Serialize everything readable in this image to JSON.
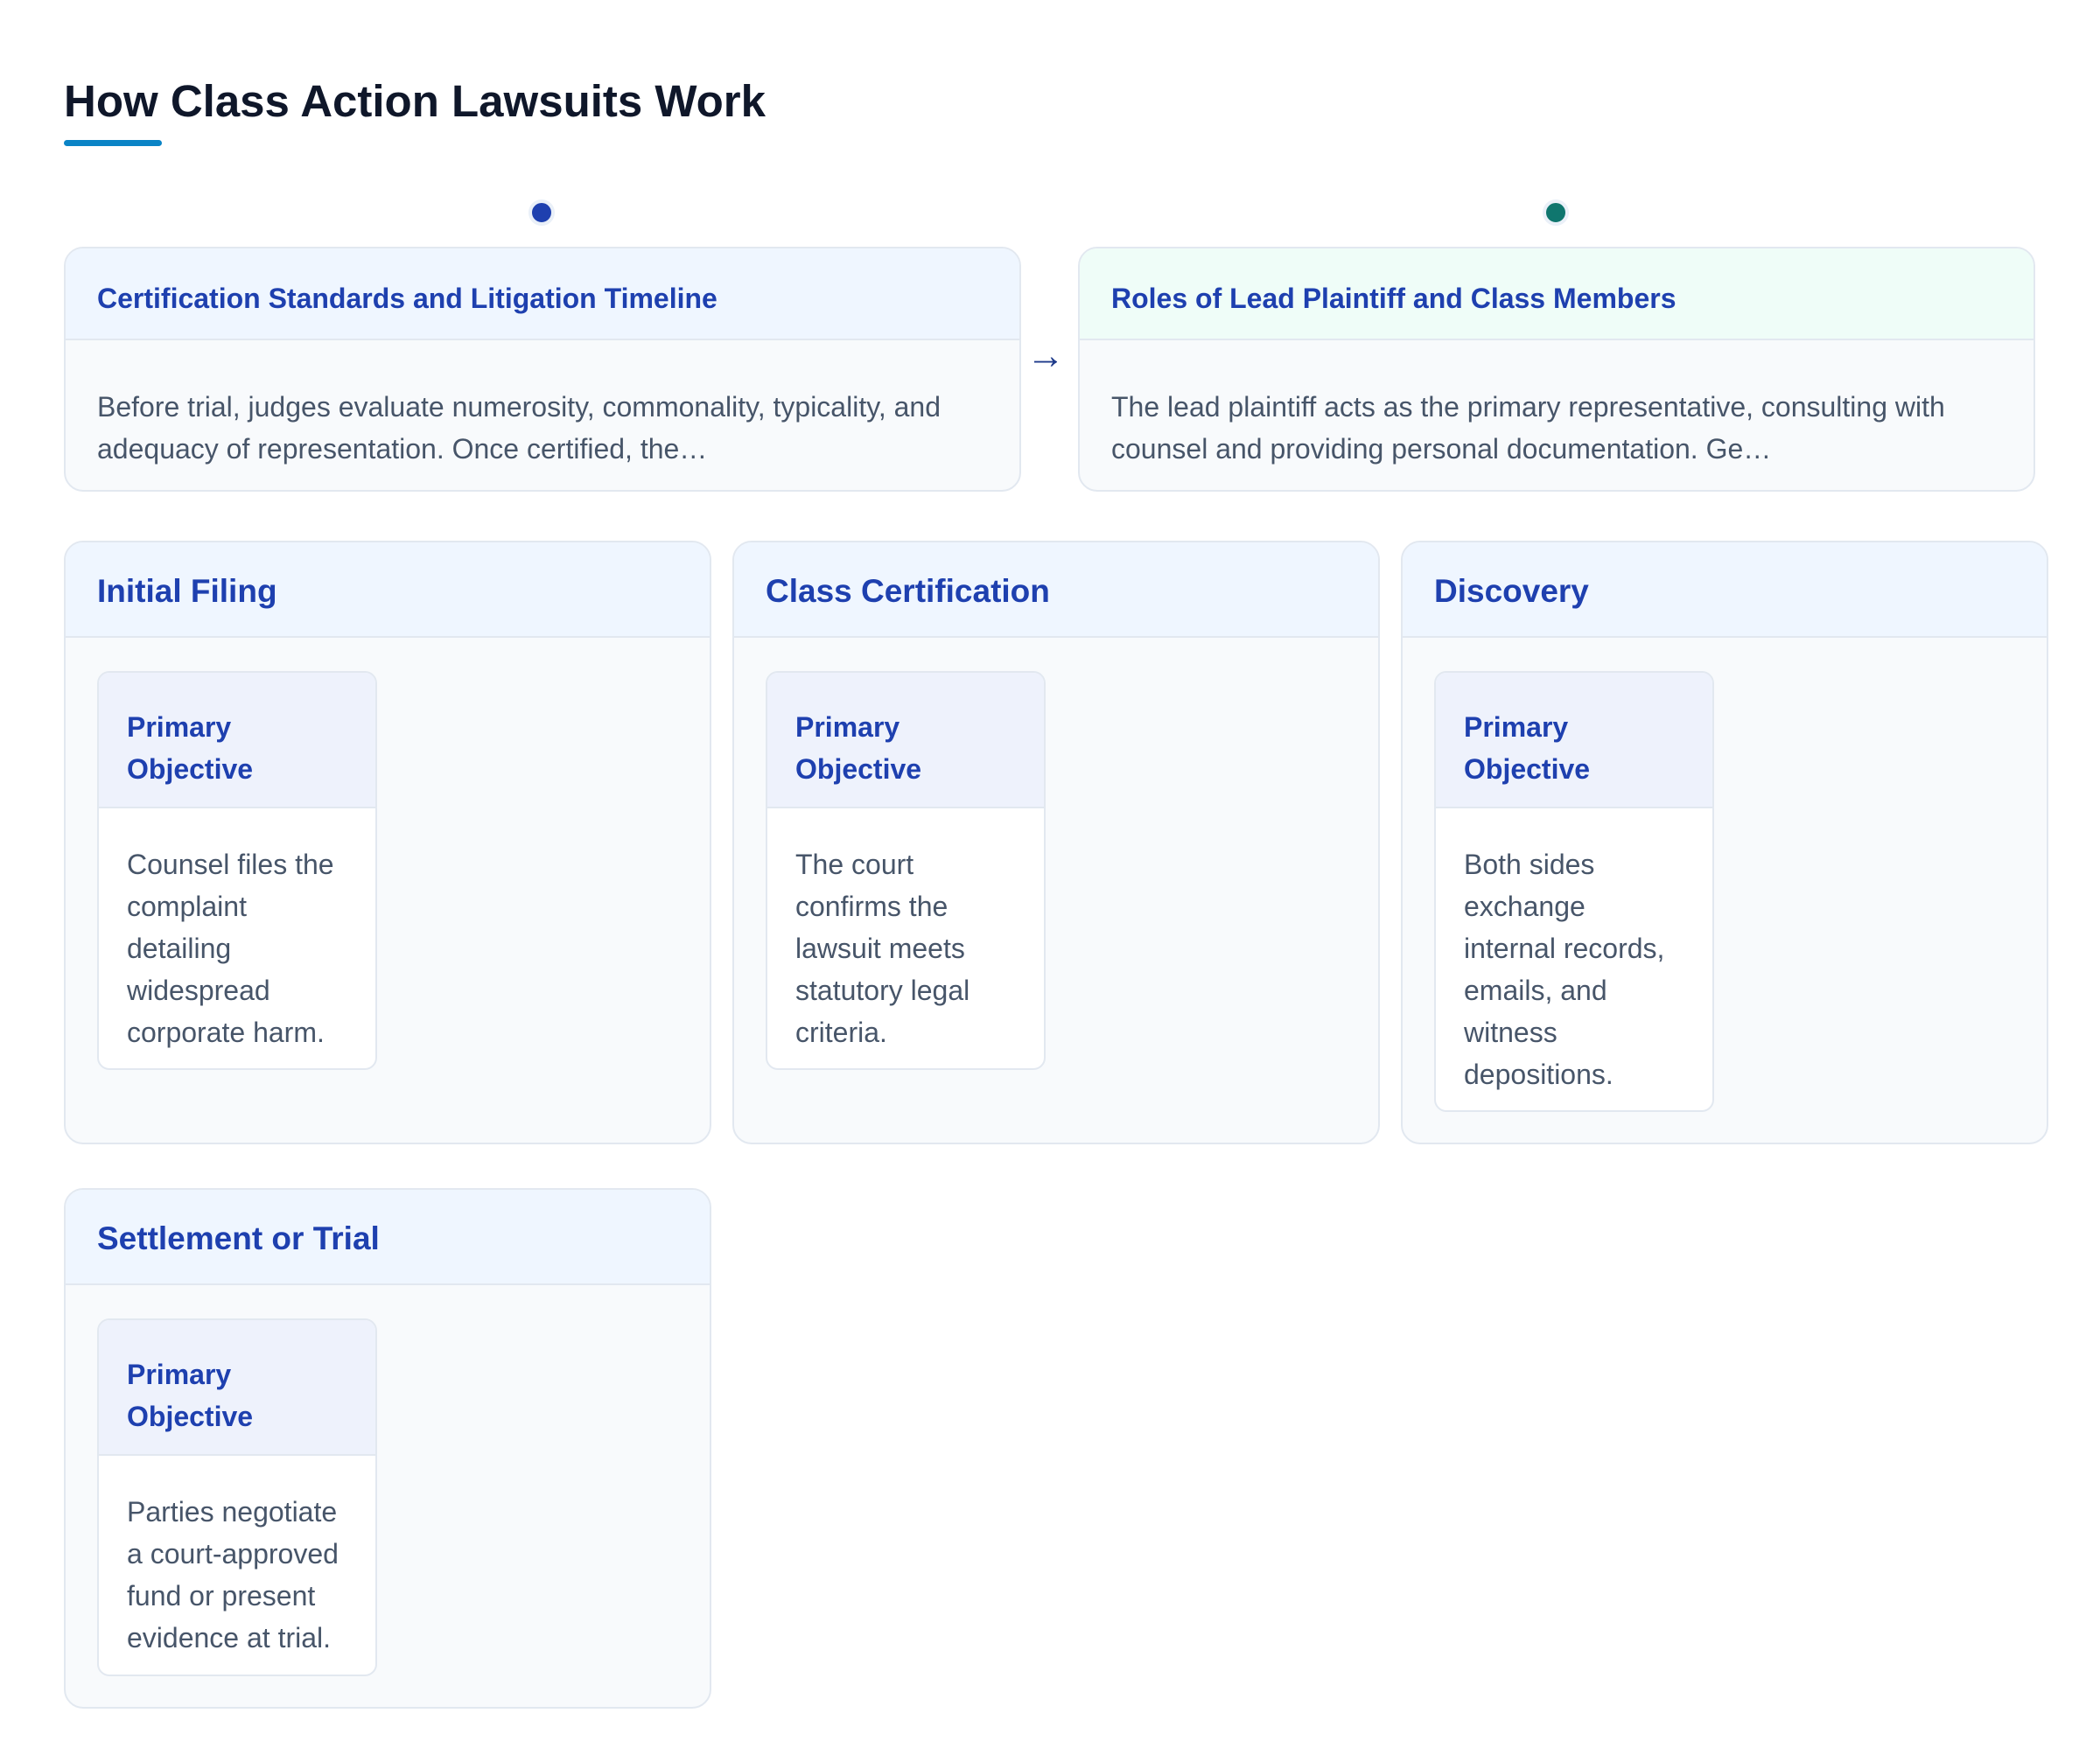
{
  "page": {
    "title": "How Class Action Lawsuits Work"
  },
  "overview": [
    {
      "title": "Certification Standards and Litigation Timeline",
      "text": "Before trial, judges evaluate numerosity, commonality, typicality, and adequacy of representation. Once certified, the…",
      "accent": "#1e40af"
    },
    {
      "title": "Roles of Lead Plaintiff and Class Members",
      "text": "The lead plaintiff acts as the primary representative, consulting with counsel and providing personal documentation. Ge…",
      "accent": "#0f766e"
    }
  ],
  "connector": {
    "arrow": "→"
  },
  "stages": [
    {
      "title": "Initial Filing",
      "objective_label": "Primary Objective",
      "objective_text": "Counsel files the complaint detailing widespread corporate harm."
    },
    {
      "title": "Class Certification",
      "objective_label": "Primary Objective",
      "objective_text": "The court confirms the lawsuit meets statutory legal criteria."
    },
    {
      "title": "Discovery",
      "objective_label": "Primary Objective",
      "objective_text": "Both sides exchange internal records, emails, and witness depositions."
    },
    {
      "title": "Settlement or Trial",
      "objective_label": "Primary Objective",
      "objective_text": "Parties negotiate a court-approved fund or present evidence at trial."
    }
  ]
}
